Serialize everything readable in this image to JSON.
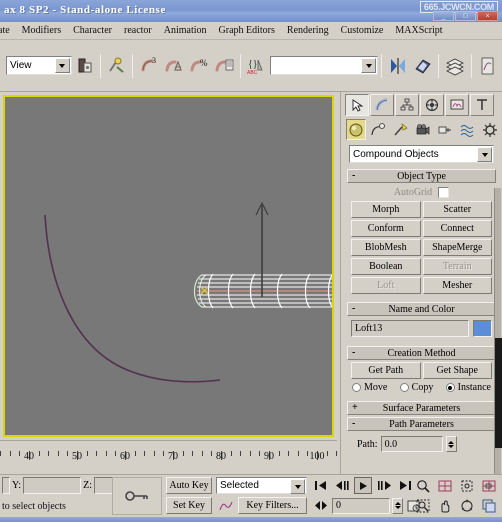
{
  "window": {
    "title": "ax 8 SP2  -  Stand-alone License",
    "watermark": "665.JCWCN.COM",
    "minimize_label": "_",
    "maximize_label": "□",
    "close_label": "×"
  },
  "menubar": {
    "items": [
      {
        "label": "ate"
      },
      {
        "label": "Modifiers"
      },
      {
        "label": "Character"
      },
      {
        "label": "reactor"
      },
      {
        "label": "Animation"
      },
      {
        "label": "Graph Editors"
      },
      {
        "label": "Rendering"
      },
      {
        "label": "Customize"
      },
      {
        "label": "MAXScript"
      }
    ]
  },
  "toolbar": {
    "reference_coordinate_system": "View",
    "named_selection_set": "",
    "icons": [
      {
        "name": "select-and-link-icon"
      },
      {
        "name": "bind-to-space-warp-icon"
      },
      {
        "name": "select-object-icon"
      },
      {
        "name": "select-by-name-icon"
      },
      {
        "name": "select-region-icon"
      },
      {
        "name": "mirror-icon"
      },
      {
        "name": "align-icon"
      },
      {
        "name": "layer-manager-icon"
      },
      {
        "name": "curve-editor-icon"
      }
    ]
  },
  "viewport": {
    "active": true,
    "background_color": "#787878",
    "border_color": "#d8d800",
    "objects": [
      {
        "name": "loft-path-spline",
        "color": "#5a3a62",
        "type": "spline"
      },
      {
        "name": "loft-mesh-wireframe",
        "color": "#ffffff",
        "type": "mesh"
      },
      {
        "name": "transform-gizmo-z-axis",
        "color": "#4a4a4a",
        "type": "gizmo"
      }
    ]
  },
  "timeline": {
    "labels": [
      "40",
      "50",
      "60",
      "70",
      "80",
      "90",
      "100"
    ]
  },
  "command_panel": {
    "tabs": [
      {
        "name": "create-tab",
        "icon": "arrow-cursor-icon",
        "active": true
      },
      {
        "name": "modify-tab",
        "icon": "curve-bend-icon",
        "active": false
      },
      {
        "name": "hierarchy-tab",
        "icon": "hierarchy-tree-icon",
        "active": false
      },
      {
        "name": "motion-tab",
        "icon": "wheel-icon",
        "active": false
      },
      {
        "name": "display-tab",
        "icon": "monitor-icon",
        "active": false
      },
      {
        "name": "utilities-tab",
        "icon": "hammer-icon",
        "active": false
      }
    ],
    "categories": [
      {
        "name": "geometry-category",
        "icon": "sphere-icon",
        "active": true
      },
      {
        "name": "shapes-category",
        "icon": "spline-icon",
        "active": false
      },
      {
        "name": "lights-category",
        "icon": "light-icon",
        "active": false
      },
      {
        "name": "cameras-category",
        "icon": "camera-icon",
        "active": false
      },
      {
        "name": "helpers-category",
        "icon": "tape-icon",
        "active": false
      },
      {
        "name": "space-warps-category",
        "icon": "wave-icon",
        "active": false
      },
      {
        "name": "systems-category",
        "icon": "gear-icon",
        "active": false
      }
    ],
    "category_dropdown": "Compound Objects",
    "object_type": {
      "title": "Object Type",
      "expanded": true,
      "sign": "-",
      "autogrid_label": "AutoGrid",
      "autogrid_checked": false,
      "buttons": [
        {
          "label": "Morph",
          "disabled": false
        },
        {
          "label": "Scatter",
          "disabled": false
        },
        {
          "label": "Conform",
          "disabled": false
        },
        {
          "label": "Connect",
          "disabled": false
        },
        {
          "label": "BlobMesh",
          "disabled": false
        },
        {
          "label": "ShapeMerge",
          "disabled": false
        },
        {
          "label": "Boolean",
          "disabled": false
        },
        {
          "label": "Terrain",
          "disabled": true
        },
        {
          "label": "Loft",
          "disabled": true
        },
        {
          "label": "Mesher",
          "disabled": false
        }
      ]
    },
    "name_and_color": {
      "title": "Name and Color",
      "sign": "-",
      "object_name": "Loft13",
      "color": "#5b8ed6"
    },
    "creation_method": {
      "title": "Creation Method",
      "sign": "-",
      "get_path_label": "Get Path",
      "get_shape_label": "Get Shape",
      "options": [
        {
          "label": "Move",
          "selected": false
        },
        {
          "label": "Copy",
          "selected": false
        },
        {
          "label": "Instance",
          "selected": true
        }
      ]
    },
    "surface_parameters": {
      "title": "Surface Parameters",
      "sign": "+",
      "expanded": false
    },
    "path_parameters": {
      "title": "Path Parameters",
      "sign": "-",
      "expanded": true,
      "path_label": "Path:",
      "path_value": "0.0"
    }
  },
  "statusbar": {
    "coord_y_label": "Y:",
    "coord_y_value": "",
    "coord_z_label": "Z:",
    "coord_z_value": "",
    "prompt": "to select objects",
    "auto_key_label": "Auto Key",
    "set_key_label": "Set Key",
    "key_mode_selection": "Selected",
    "key_filters_label": "Key Filters...",
    "current_frame": "0",
    "playback_icons": [
      {
        "name": "go-to-start-icon",
        "glyph": "⏮"
      },
      {
        "name": "previous-frame-icon",
        "glyph": "◀"
      },
      {
        "name": "play-animation-icon",
        "glyph": "▶"
      },
      {
        "name": "next-frame-icon",
        "glyph": "▶"
      },
      {
        "name": "go-to-end-icon",
        "glyph": "⏭"
      }
    ],
    "nav_icons": [
      {
        "name": "zoom-icon"
      },
      {
        "name": "zoom-all-icon"
      },
      {
        "name": "zoom-extents-icon"
      },
      {
        "name": "zoom-extents-all-icon"
      },
      {
        "name": "region-zoom-icon"
      },
      {
        "name": "pan-icon"
      },
      {
        "name": "arc-rotate-icon"
      },
      {
        "name": "maximize-viewport-icon"
      }
    ]
  }
}
